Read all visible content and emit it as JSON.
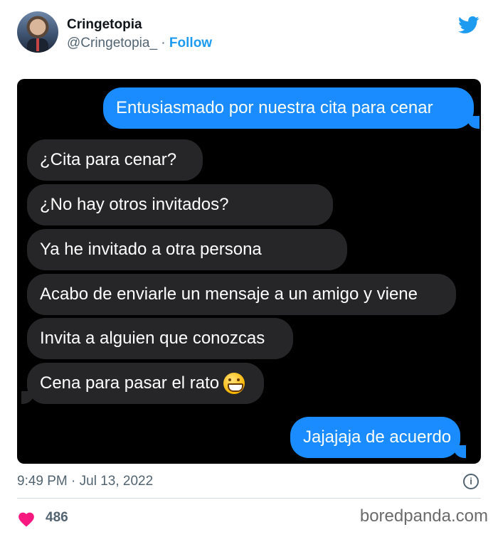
{
  "tweet": {
    "display_name": "Cringetopia",
    "handle": "@Cringetopia_",
    "separator": " · ",
    "follow_label": "Follow",
    "timestamp": "9:49 PM · Jul 13, 2022",
    "likes": "486"
  },
  "messages": [
    {
      "sender": "me",
      "text": "Entusiasmado por nuestra cita para cenar"
    },
    {
      "sender": "them",
      "text": "¿Cita para cenar?"
    },
    {
      "sender": "them",
      "text": "¿No hay otros invitados?"
    },
    {
      "sender": "them",
      "text": "Ya he invitado a otra persona"
    },
    {
      "sender": "them",
      "text": "Acabo de enviarle un mensaje a un amigo y viene"
    },
    {
      "sender": "them",
      "text": "Invita a alguien que conozcas"
    },
    {
      "sender": "them",
      "text": "Cena para pasar el rato",
      "emoji": "grinning-face-icon"
    },
    {
      "sender": "me",
      "text": "Jajajaja de acuerdo"
    }
  ],
  "colors": {
    "sent_bubble": "#1a8cff",
    "received_bubble": "#262628",
    "twitter_blue": "#1d9bf0",
    "like_pink": "#f91880"
  },
  "watermark": "boredpanda.com"
}
